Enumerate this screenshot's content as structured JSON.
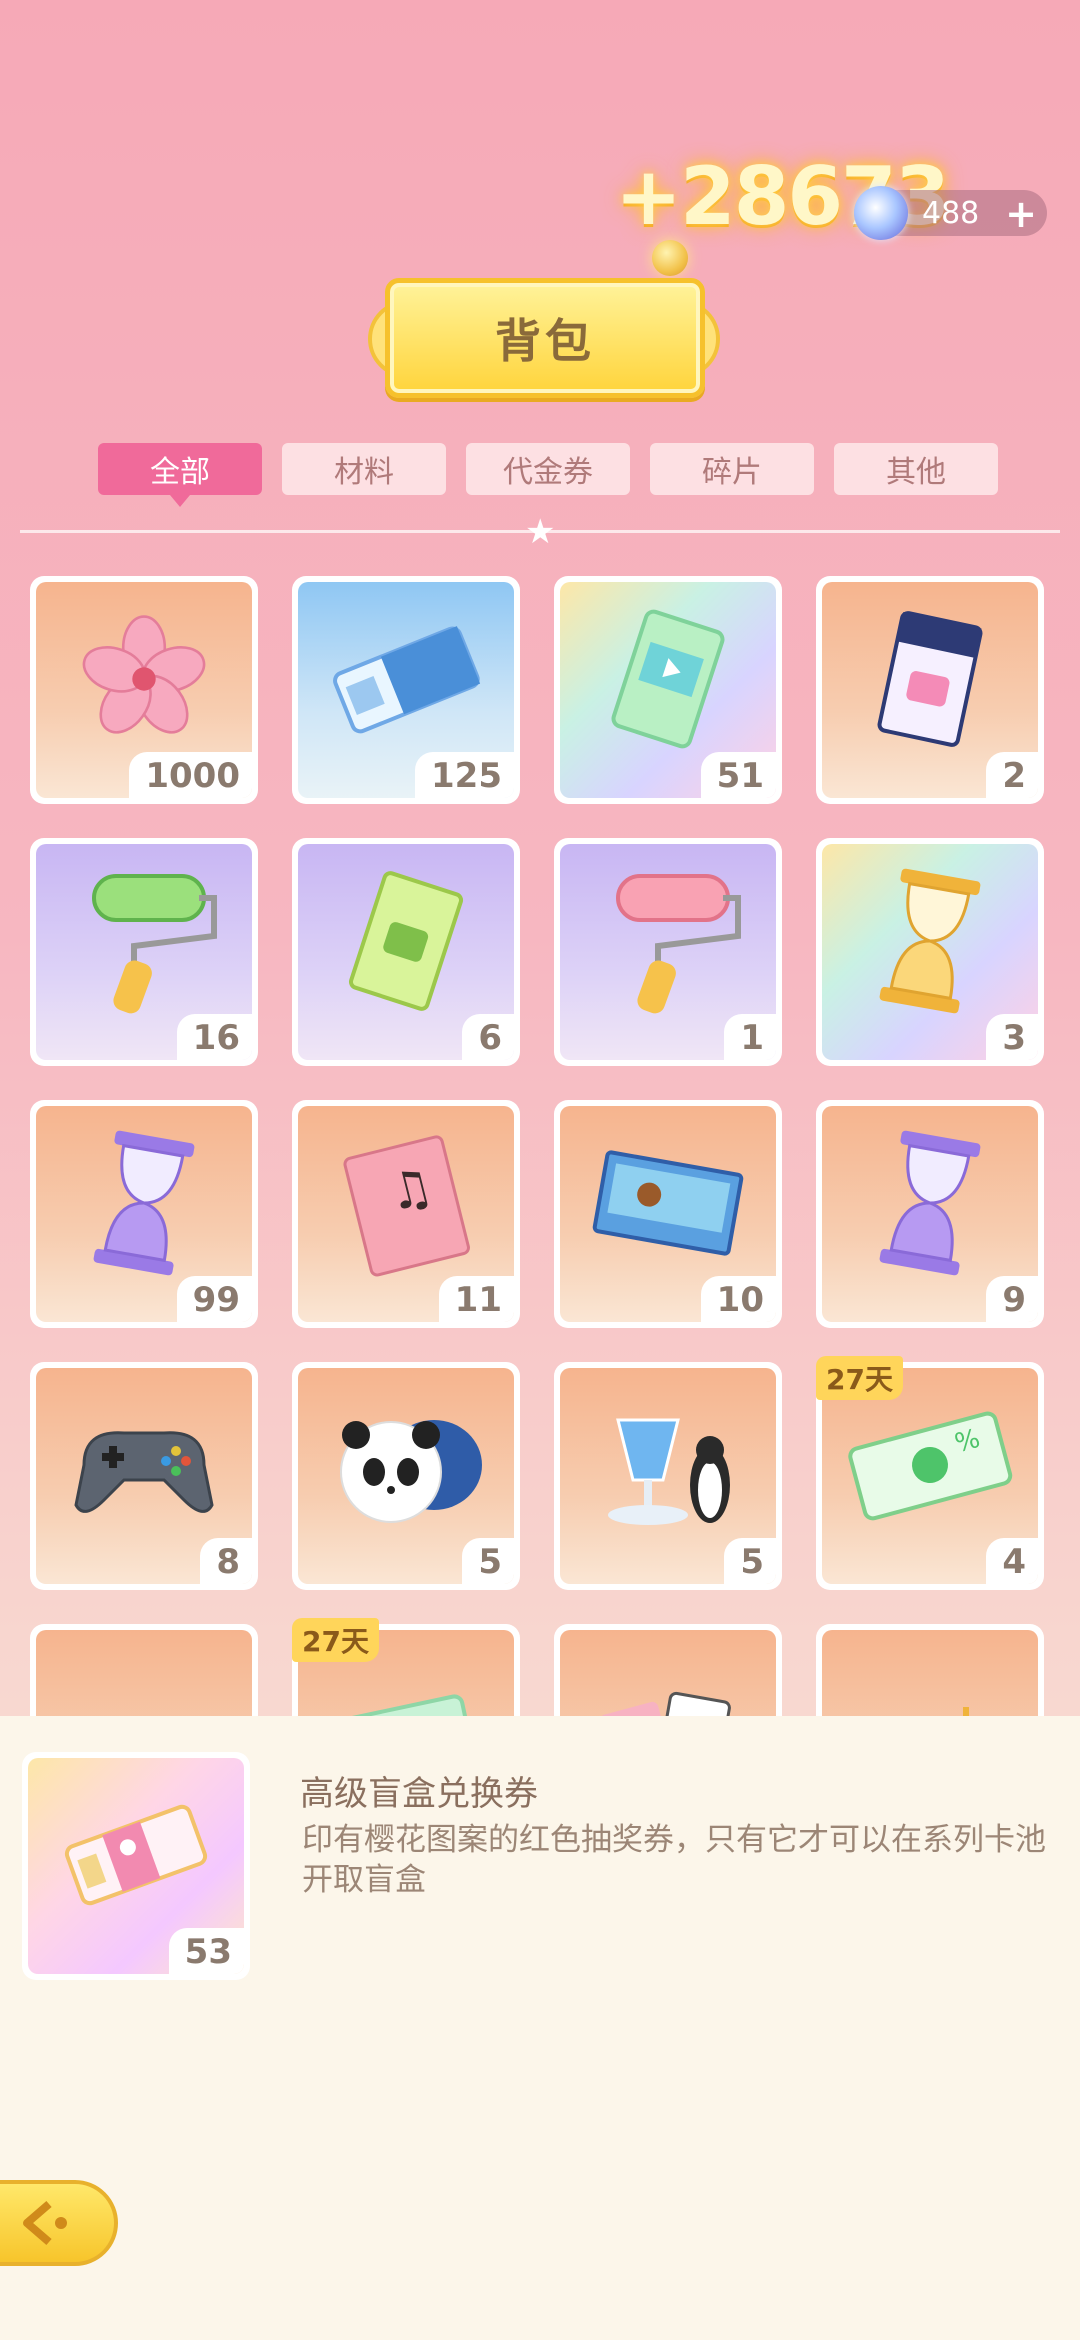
{
  "currency": {
    "coin_gain": "+28673",
    "gem_count": "488",
    "gem_plus": "+"
  },
  "title": "背包",
  "tabs": [
    {
      "label": "全部",
      "active": true
    },
    {
      "label": "材料",
      "active": false
    },
    {
      "label": "代金券",
      "active": false
    },
    {
      "label": "碎片",
      "active": false
    },
    {
      "label": "其他",
      "active": false
    }
  ],
  "items": [
    {
      "icon": "sakura-flower-icon",
      "count": "1000",
      "bg": "orange"
    },
    {
      "icon": "blue-ticket-icon",
      "count": "125",
      "bg": "blue"
    },
    {
      "icon": "film-ticket-icon",
      "count": "51",
      "bg": "rainbow"
    },
    {
      "icon": "dark-blue-ticket-icon",
      "count": "2",
      "bg": "orange"
    },
    {
      "icon": "green-paint-roller-icon",
      "count": "16",
      "bg": "purple"
    },
    {
      "icon": "green-ticket-icon",
      "count": "6",
      "bg": "purple"
    },
    {
      "icon": "pink-paint-roller-icon",
      "count": "1",
      "bg": "purple"
    },
    {
      "icon": "golden-hourglass-icon",
      "count": "3",
      "bg": "rainbow"
    },
    {
      "icon": "purple-hourglass-icon",
      "count": "99",
      "bg": "orange"
    },
    {
      "icon": "music-book-icon",
      "count": "11",
      "bg": "orange"
    },
    {
      "icon": "puzzle-box-icon",
      "count": "10",
      "bg": "orange"
    },
    {
      "icon": "purple-hourglass-icon",
      "count": "9",
      "bg": "orange"
    },
    {
      "icon": "game-controller-icon",
      "count": "8",
      "bg": "orange"
    },
    {
      "icon": "panda-plush-icon",
      "count": "5",
      "bg": "orange"
    },
    {
      "icon": "drink-penguin-icon",
      "count": "5",
      "bg": "orange"
    },
    {
      "icon": "sale-coupon-icon",
      "count": "4",
      "bg": "orange",
      "badge": "27天"
    },
    {
      "icon": "bunny-bow-icon",
      "count": "",
      "bg": "orange"
    },
    {
      "icon": "green-card-icon",
      "count": "",
      "bg": "orange",
      "badge": "27天"
    },
    {
      "icon": "card-deck-icon",
      "count": "",
      "bg": "orange"
    },
    {
      "icon": "bunny-dessert-icon",
      "count": "",
      "bg": "orange"
    }
  ],
  "detail": {
    "icon": "premium-blind-box-ticket-icon",
    "count": "53",
    "name": "高级盲盒兑换券",
    "description": "印有樱花图案的红色抽奖券，只有它才可以在系列卡池开取盲盒"
  },
  "colors": {
    "accent": "#f06a9a",
    "banner": "#ffd43b",
    "panel": "#fcf6ea"
  }
}
